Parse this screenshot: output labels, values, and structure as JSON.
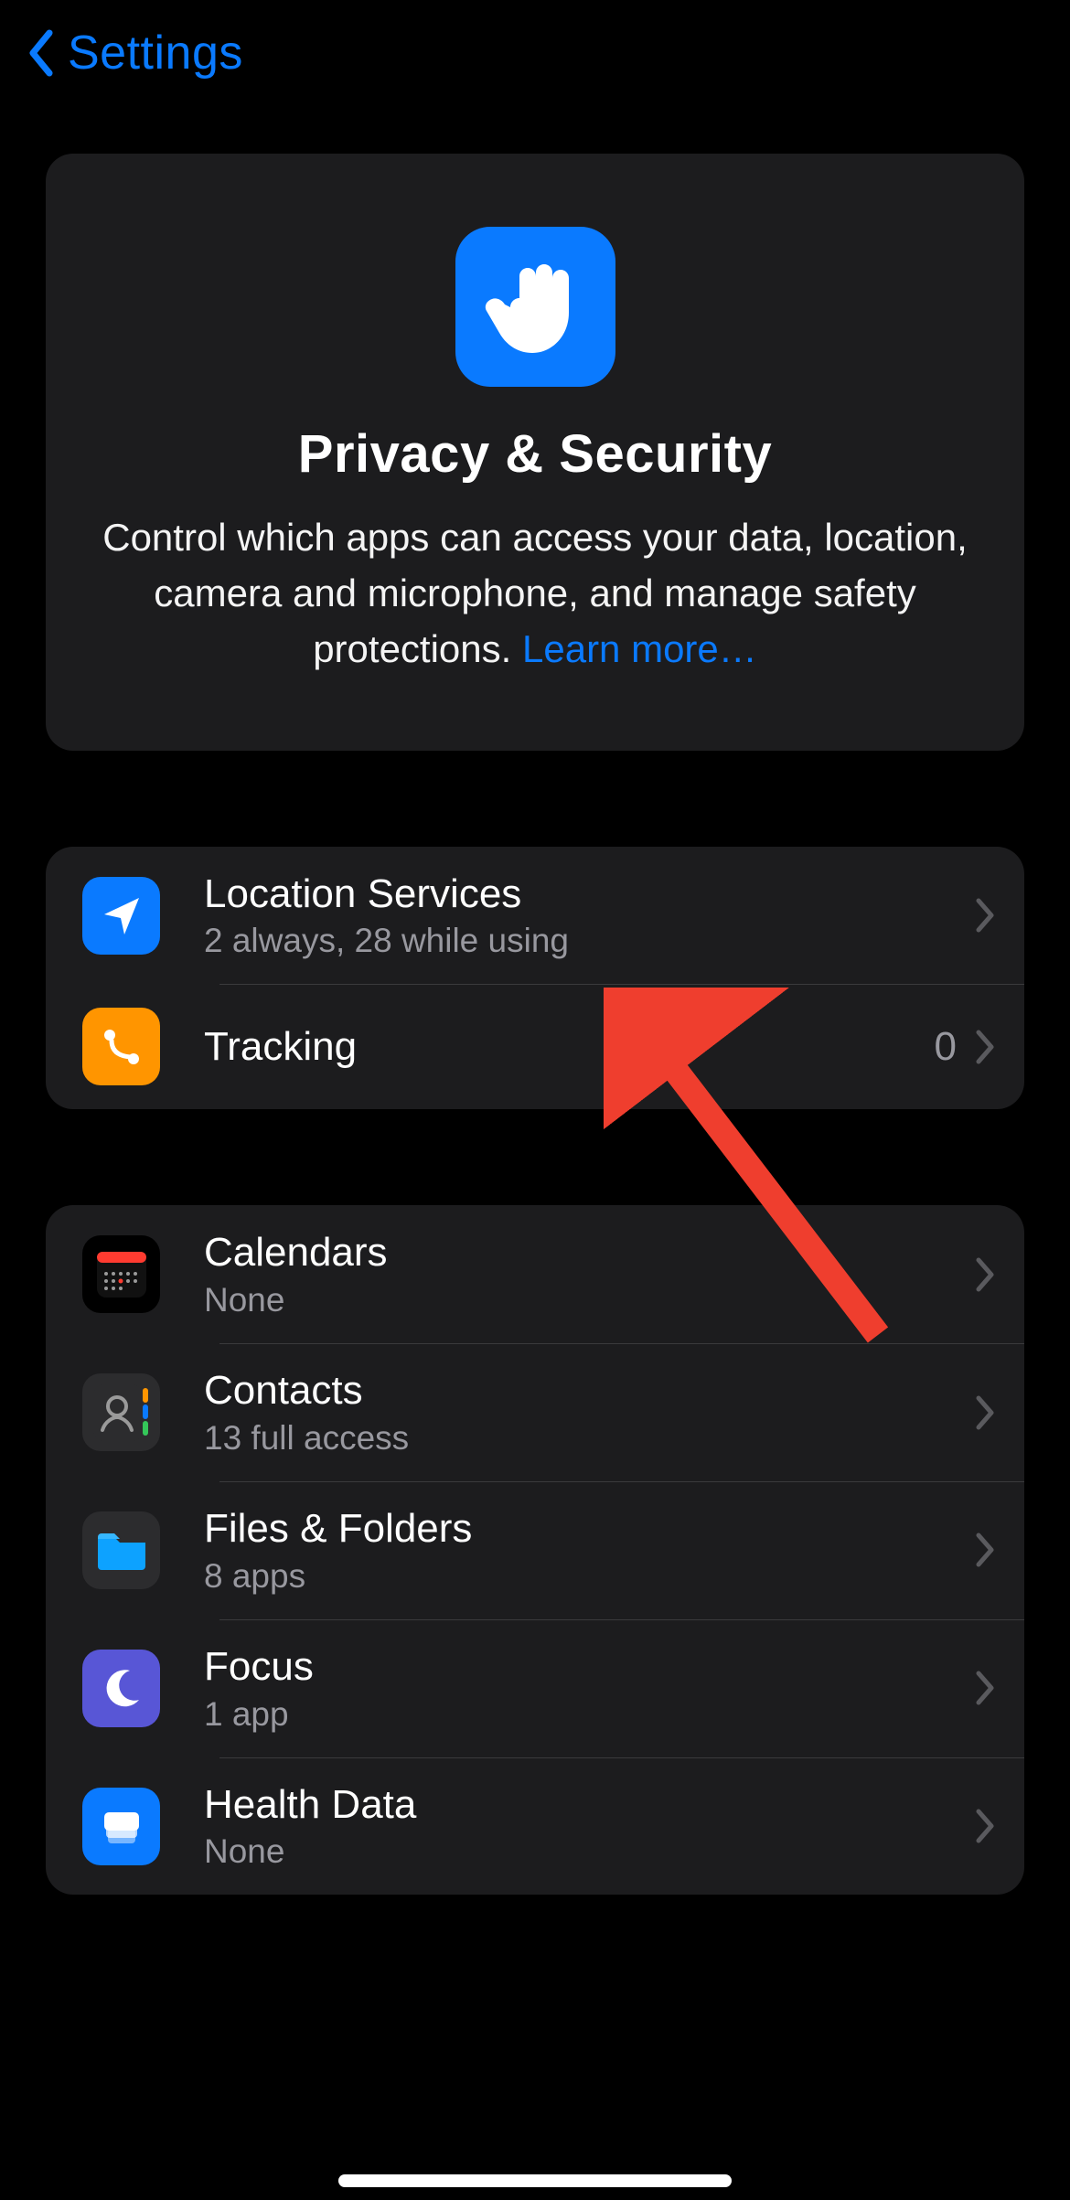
{
  "nav": {
    "back_label": "Settings"
  },
  "header": {
    "title": "Privacy & Security",
    "description": "Control which apps can access your data, location, camera and microphone, and manage safety protections. ",
    "learn_more": "Learn more…"
  },
  "groups": [
    {
      "rows": [
        {
          "icon": "location-icon",
          "icon_color": "#0a7aff",
          "label": "Location Services",
          "sublabel": "2 always, 28 while using",
          "value": ""
        },
        {
          "icon": "tracking-icon",
          "icon_color": "#ff9500",
          "label": "Tracking",
          "sublabel": "",
          "value": "0"
        }
      ]
    },
    {
      "rows": [
        {
          "icon": "calendar-icon",
          "icon_color": "#1c1c1e",
          "label": "Calendars",
          "sublabel": "None",
          "value": ""
        },
        {
          "icon": "contacts-icon",
          "icon_color": "#1c1c1e",
          "label": "Contacts",
          "sublabel": "13 full access",
          "value": ""
        },
        {
          "icon": "files-icon",
          "icon_color": "#1c1c1e",
          "label": "Files & Folders",
          "sublabel": "8 apps",
          "value": ""
        },
        {
          "icon": "focus-icon",
          "icon_color": "#5856d6",
          "label": "Focus",
          "sublabel": "1 app",
          "value": ""
        },
        {
          "icon": "health-icon",
          "icon_color": "#0a7aff",
          "label": "Health Data",
          "sublabel": "None",
          "value": ""
        }
      ]
    }
  ],
  "annotation": {
    "arrow_color": "#ef3e2e"
  }
}
